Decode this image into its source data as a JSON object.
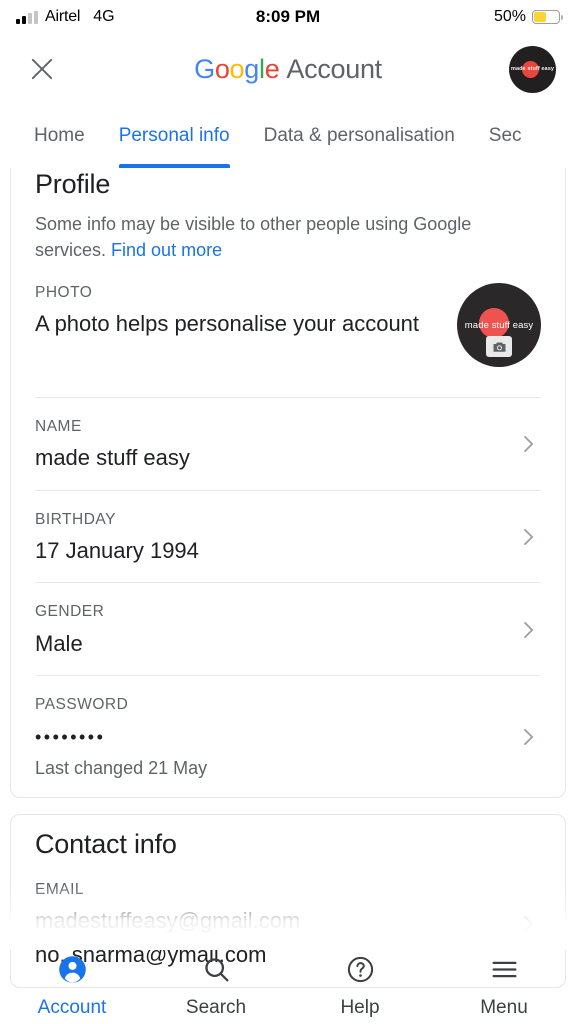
{
  "status_bar": {
    "carrier": "Airtel",
    "network": "4G",
    "time": "8:09 PM",
    "battery_percent": "50%",
    "battery_level": 50,
    "battery_color": "#fcd535",
    "signal_icon": "signal-bars-icon",
    "battery_icon": "battery-icon"
  },
  "app_bar": {
    "close_icon": "close-icon",
    "brand": {
      "g1": "G",
      "o1": "o",
      "o2": "o",
      "g2": "g",
      "l": "l",
      "e": "e",
      "suffix": "Account"
    },
    "avatar": {
      "name": "made stuff easy",
      "icon": "avatar"
    }
  },
  "tabs": [
    {
      "label": "Home",
      "active": false
    },
    {
      "label": "Personal info",
      "active": true
    },
    {
      "label": "Data & personalisation",
      "active": false
    },
    {
      "label": "Sec",
      "active": false
    }
  ],
  "profile_card": {
    "title": "Profile",
    "subtitle_text": "Some info may be visible to other people using Google services.",
    "subtitle_link": "Find out more",
    "rows": [
      {
        "label": "PHOTO",
        "value": "A photo helps personalise your account",
        "avatar_name": "made stuff easy",
        "camera_icon": "camera-icon"
      },
      {
        "label": "NAME",
        "value": "made stuff easy",
        "chevron": "chevron-right-icon"
      },
      {
        "label": "BIRTHDAY",
        "value": "17 January 1994",
        "chevron": "chevron-right-icon"
      },
      {
        "label": "GENDER",
        "value": "Male",
        "chevron": "chevron-right-icon"
      },
      {
        "label": "PASSWORD",
        "value": "••••••••",
        "sub": "Last changed 21 May",
        "chevron": "chevron-right-icon"
      }
    ]
  },
  "contact_card": {
    "title": "Contact info",
    "rows": [
      {
        "label": "EMAIL",
        "value": "madestuffeasy@gmail.com",
        "value2": "no..sharma@ymail.com",
        "chevron": "chevron-right-icon"
      }
    ]
  },
  "bottom_bar": [
    {
      "label": "Account",
      "icon": "person-icon",
      "active": true
    },
    {
      "label": "Search",
      "icon": "search-icon",
      "active": false
    },
    {
      "label": "Help",
      "icon": "help-circle-icon",
      "active": false
    },
    {
      "label": "Menu",
      "icon": "hamburger-menu-icon",
      "active": false
    }
  ],
  "colors": {
    "accent": "#1a73e8",
    "text_primary": "#202124",
    "text_secondary": "#5f6368"
  }
}
